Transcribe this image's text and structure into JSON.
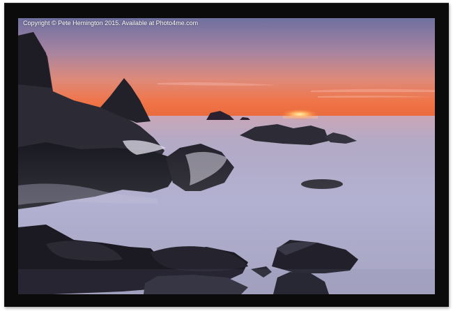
{
  "watermark": {
    "text": "Copyright © Pete Hemington 2015. Available at Photo4me.com"
  },
  "photo": {
    "subject": "sunset-over-rocky-coast",
    "colors": {
      "sky_top": "#7d7aa8",
      "sky_mid": "#d98878",
      "horizon": "#f06a3a",
      "sea": "#a9a7c8",
      "rocks": "#1c1c24"
    }
  },
  "frame": {
    "color": "#0b0b0b"
  }
}
